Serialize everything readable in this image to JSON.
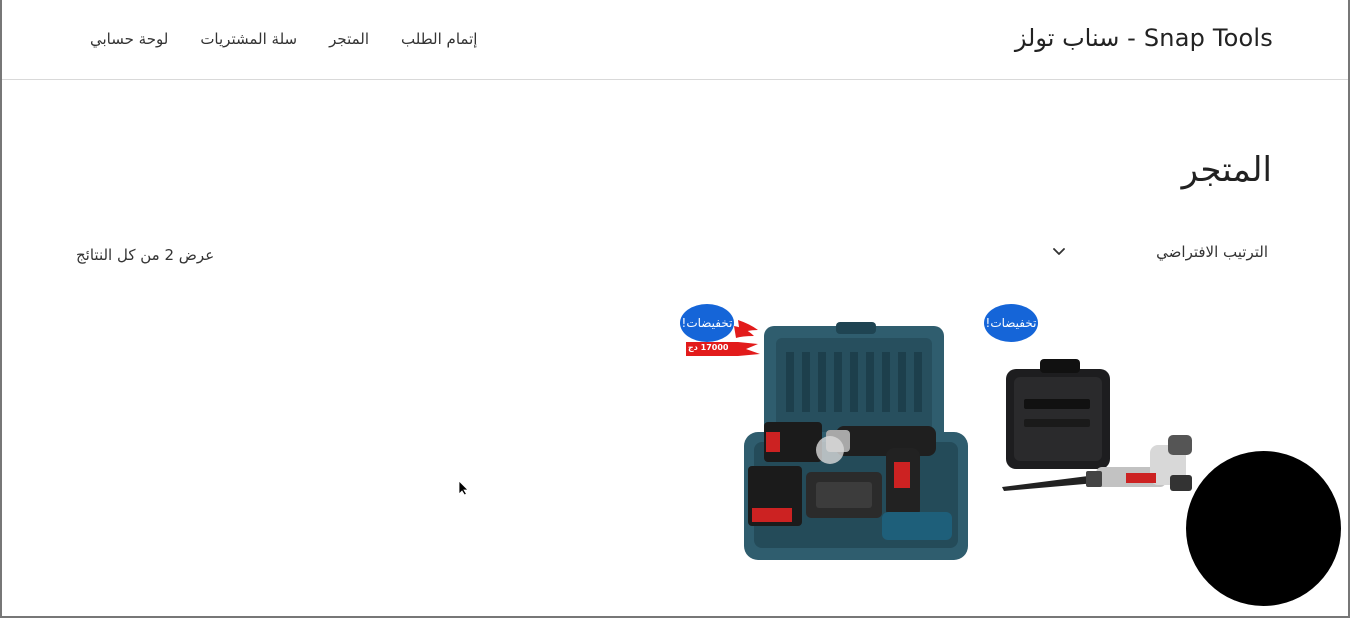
{
  "header": {
    "site_title": "Snap Tools - سناب تولز",
    "nav": [
      {
        "label": "إتمام الطلب",
        "key": "checkout"
      },
      {
        "label": "المتجر",
        "key": "shop"
      },
      {
        "label": "سلة المشتريات",
        "key": "cart"
      },
      {
        "label": "لوحة حسابي",
        "key": "account"
      }
    ]
  },
  "page": {
    "title": "المتجر"
  },
  "toolbar": {
    "ordering_label": "الترتيب الافتراضي",
    "result_count": "عرض 2 من كل النتائج"
  },
  "products": [
    {
      "sale_badge": "تخفيضات!",
      "image_icon": "reciprocating-saw-kit-icon"
    },
    {
      "sale_badge": "تخفيضات!",
      "image_icon": "cordless-drill-kit-icon",
      "price_tag": "17000 دج"
    }
  ],
  "colors": {
    "accent": "#1565d8",
    "case_teal": "#2f5d6e",
    "badge_red": "#e21b1b"
  }
}
